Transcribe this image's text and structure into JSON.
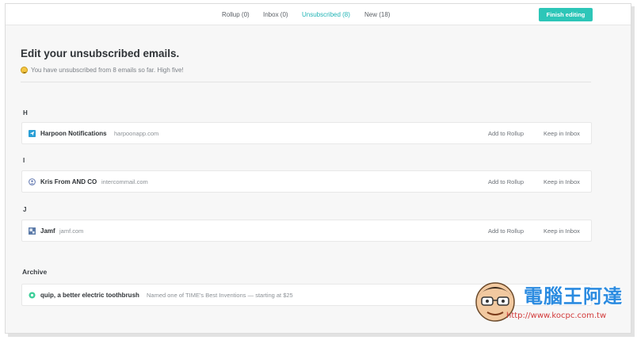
{
  "tabs": [
    {
      "label": "Rollup (0)",
      "active": false
    },
    {
      "label": "Inbox (0)",
      "active": false
    },
    {
      "label": "Unsubscribed (8)",
      "active": true
    },
    {
      "label": "New (18)",
      "active": false
    }
  ],
  "finish_button": "Finish editing",
  "page": {
    "title": "Edit your unsubscribed emails.",
    "subtitle": "You have unsubscribed from 8 emails so far. High five!"
  },
  "groups": [
    {
      "letter": "H",
      "items": [
        {
          "name": "Harpoon Notifications",
          "domain": "harpoonapp.com",
          "icon": "paper-plane-icon",
          "rollup": "Add to Rollup",
          "inbox": "Keep in Inbox"
        }
      ]
    },
    {
      "letter": "I",
      "items": [
        {
          "name": "Kris From AND CO",
          "domain": "intercommail.com",
          "icon": "circle-avatar-icon",
          "rollup": "Add to Rollup",
          "inbox": "Keep in Inbox"
        }
      ]
    },
    {
      "letter": "J",
      "items": [
        {
          "name": "Jamf",
          "domain": "jamf.com",
          "icon": "jamf-logo-icon",
          "rollup": "Add to Rollup",
          "inbox": "Keep in Inbox"
        }
      ]
    }
  ],
  "archive": {
    "label": "Archive",
    "item": {
      "name": "quip, a better electric toothbrush",
      "domain": "Named one of TIME's Best Inventions — starting at $25",
      "icon": "quip-icon"
    }
  },
  "watermark": {
    "text": "電腦王阿達",
    "url": "http://www.kocpc.com.tw"
  },
  "colors": {
    "accent": "#21b4b5",
    "button": "#2dc6b8",
    "watermark_blue": "#2b8be0",
    "watermark_red": "#d23a3a"
  }
}
